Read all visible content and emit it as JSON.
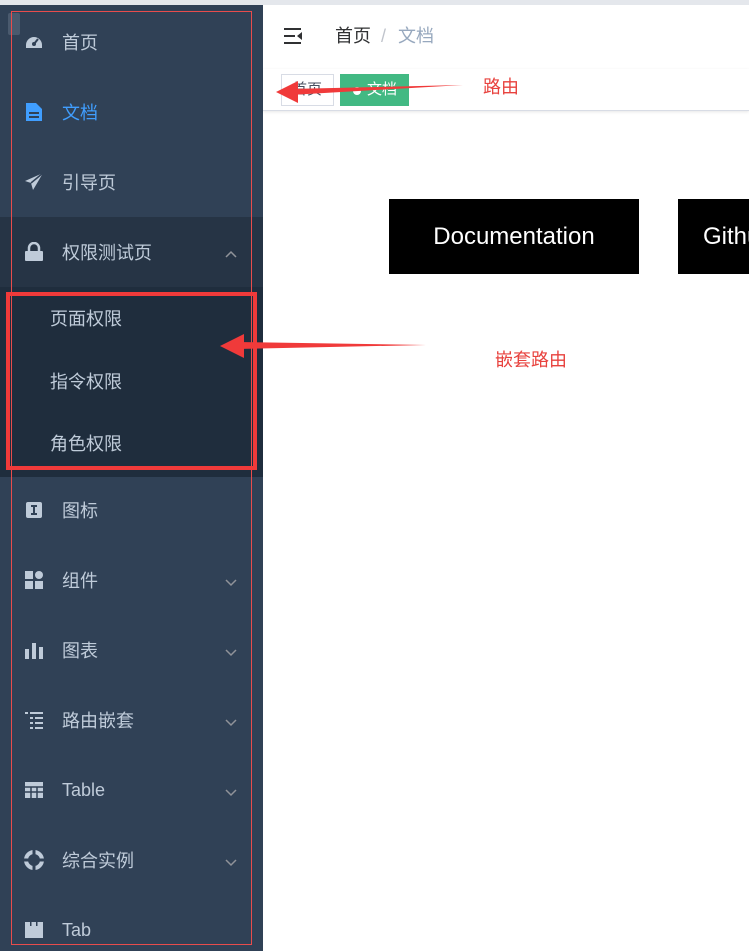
{
  "sidebar": {
    "items": [
      {
        "label": "首页",
        "icon": "dashboard-icon"
      },
      {
        "label": "文档",
        "icon": "document-icon",
        "active": true
      },
      {
        "label": "引导页",
        "icon": "paper-plane-icon"
      },
      {
        "label": "权限测试页",
        "icon": "lock-icon",
        "expanded": true
      },
      {
        "label": "图标",
        "icon": "icon-font-icon"
      },
      {
        "label": "组件",
        "icon": "component-icon"
      },
      {
        "label": "图表",
        "icon": "chart-icon"
      },
      {
        "label": "路由嵌套",
        "icon": "nested-icon"
      },
      {
        "label": "Table",
        "icon": "table-icon"
      },
      {
        "label": "综合实例",
        "icon": "example-icon"
      },
      {
        "label": "Tab",
        "icon": "tab-icon"
      }
    ],
    "submenu": [
      {
        "label": "页面权限"
      },
      {
        "label": "指令权限"
      },
      {
        "label": "角色权限"
      }
    ]
  },
  "breadcrumb": {
    "home": "首页",
    "separator": "/",
    "current": "文档"
  },
  "tags": {
    "home": "首页",
    "doc": "文档"
  },
  "main": {
    "doc_button": "Documentation",
    "github_button": "Github"
  },
  "annotations": {
    "route": "路由",
    "nested_route": "嵌套路由"
  },
  "colors": {
    "sidebar_bg": "#304156",
    "submenu_bg": "#1f2d3d",
    "active": "#409eff",
    "tag_active": "#42b983",
    "annotation": "#e8423e"
  }
}
